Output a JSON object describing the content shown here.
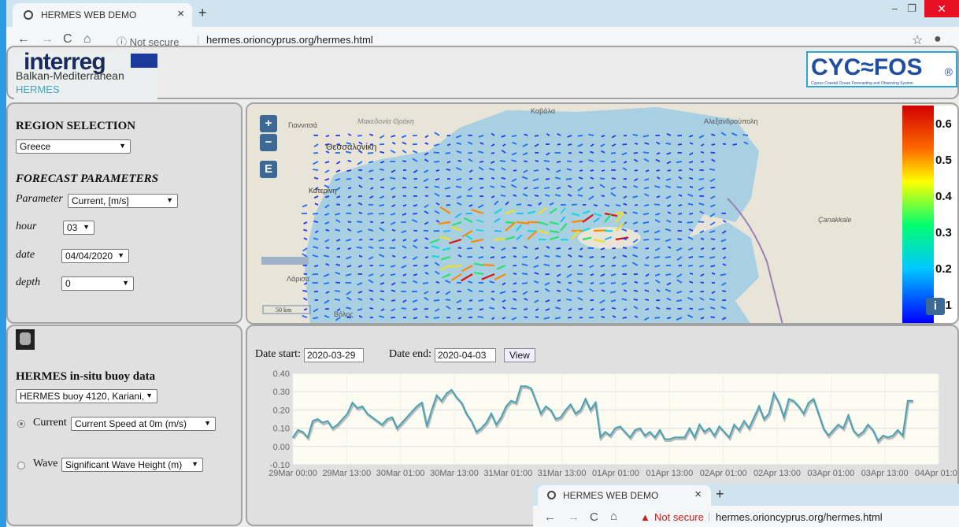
{
  "browser": {
    "tab_title": "HERMES WEB DEMO",
    "tab_close": "×",
    "new_tab": "+",
    "security": "Not secure",
    "url": "hermes.orioncyprus.org/hermes.html",
    "minimize": "–",
    "restore": "❐",
    "close": "✕"
  },
  "header": {
    "interreg_logo": "interreg",
    "program": "Balkan-Mediterranean",
    "project": "HERMES",
    "cycofos_logo": "CYC≈FOS",
    "cycofos_registered": "®",
    "cycofos_sub": "Cyprus Coastal Ocean Forecasting and Observing System"
  },
  "region": {
    "heading": "REGION SELECTION",
    "region_value": "Greece",
    "forecast_heading": "FORECAST PARAMETERS",
    "parameter_label": "Parameter",
    "parameter_value": "Current, [m/s]",
    "hour_label": "hour",
    "hour_value": "03",
    "date_label": "date",
    "date_value": "04/04/2020",
    "depth_label": "depth",
    "depth_value": "0"
  },
  "map": {
    "zoom_in": "+",
    "zoom_out": "−",
    "extent_btn": "E",
    "scale": "50 km",
    "places": [
      "Καβάλα",
      "Μακεδονία Θράκη",
      "Θεσσαλονίκη",
      "Αλεξανδρούπολη",
      "Κατερίνη",
      "Çanakkale",
      "Λάρισα",
      "Βόλος",
      "Γιαννιτσά"
    ],
    "legend_labels": [
      "0.6",
      "0.5",
      "0.4",
      "0.3",
      "0.2",
      "0.1"
    ],
    "info_btn": "i"
  },
  "buoy": {
    "heading": "HERMES in-situ buoy data",
    "buoy_value": "HERMES buoy 4120, Kariani,",
    "current_label": "Current",
    "current_value": "Current Speed at 0m (m/s)",
    "wave_label": "Wave",
    "wave_value": "Significant Wave Height (m)"
  },
  "chart_controls": {
    "start_label": "Date start:",
    "start_value": "2020-03-29",
    "end_label": "Date end:",
    "end_value": "2020-04-03",
    "view_button": "View"
  },
  "chart_data": {
    "type": "line",
    "title": "",
    "xlabel": "",
    "ylabel": "",
    "ylim": [
      -0.1,
      0.4
    ],
    "yticks": [
      "0.40",
      "0.30",
      "0.20",
      "0.10",
      "0.00",
      "-0.10"
    ],
    "xticks": [
      "29Mar 00:00",
      "29Mar 13:00",
      "30Mar 01:00",
      "30Mar 13:00",
      "31Mar 01:00",
      "31Mar 13:00",
      "01Apr 01:00",
      "01Apr 13:00",
      "02Apr 01:00",
      "02Apr 13:00",
      "03Apr 01:00",
      "03Apr 13:00",
      "04Apr 01:00"
    ],
    "grid": true,
    "color": "#4aa3b3",
    "series": [
      {
        "values": [
          0.05,
          0.09,
          0.08,
          0.05,
          0.14,
          0.15,
          0.13,
          0.14,
          0.1,
          0.12,
          0.15,
          0.18,
          0.24,
          0.21,
          0.22,
          0.18,
          0.16,
          0.14,
          0.12,
          0.15,
          0.16,
          0.1,
          0.13,
          0.16,
          0.19,
          0.22,
          0.24,
          0.11,
          0.2,
          0.28,
          0.25,
          0.29,
          0.31,
          0.27,
          0.24,
          0.18,
          0.14,
          0.08,
          0.1,
          0.13,
          0.18,
          0.12,
          0.16,
          0.22,
          0.25,
          0.24,
          0.33,
          0.33,
          0.32,
          0.25,
          0.18,
          0.22,
          0.2,
          0.15,
          0.16,
          0.2,
          0.23,
          0.18,
          0.2,
          0.26,
          0.2,
          0.24,
          0.05,
          0.08,
          0.06,
          0.1,
          0.11,
          0.08,
          0.05,
          0.09,
          0.1,
          0.06,
          0.08,
          0.05,
          0.09,
          0.04,
          0.04,
          0.05,
          0.05,
          0.05,
          0.1,
          0.05,
          0.12,
          0.08,
          0.1,
          0.06,
          0.11,
          0.08,
          0.05,
          0.12,
          0.09,
          0.14,
          0.1,
          0.16,
          0.22,
          0.15,
          0.18,
          0.29,
          0.24,
          0.16,
          0.26,
          0.25,
          0.22,
          0.18,
          0.24,
          0.26,
          0.18,
          0.1,
          0.06,
          0.09,
          0.12,
          0.1,
          0.17,
          0.09,
          0.06,
          0.08,
          0.12,
          0.09,
          0.03,
          0.06,
          0.05,
          0.06,
          0.09,
          0.06,
          0.25,
          0.25
        ]
      }
    ]
  }
}
